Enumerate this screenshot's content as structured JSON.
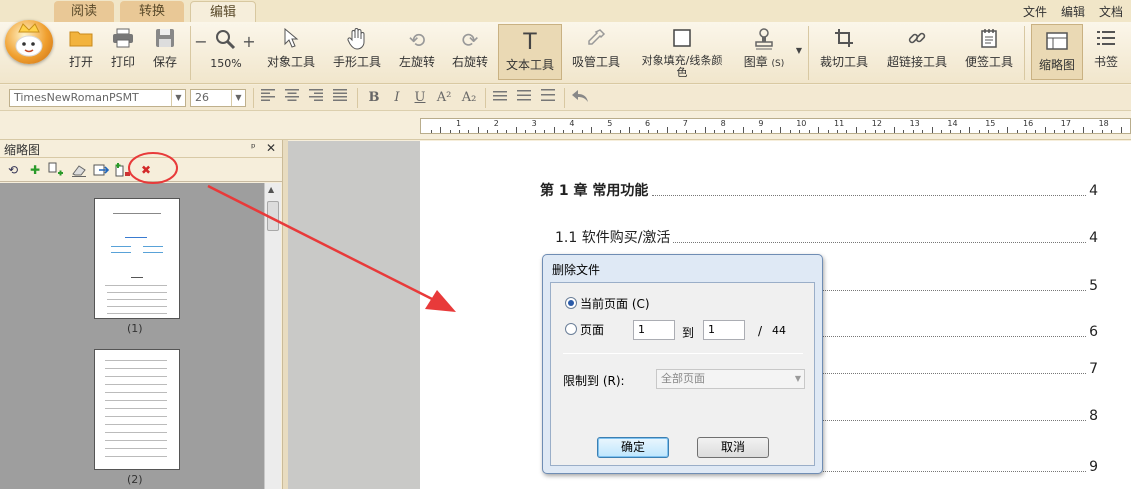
{
  "tabs": {
    "read": "阅读",
    "convert": "转换",
    "edit": "编辑"
  },
  "top_menu": {
    "file": "文件",
    "edit": "编辑",
    "doc": "文档"
  },
  "toolbar": {
    "open": "打开",
    "print": "打印",
    "save": "保存",
    "zoom_minus": "−",
    "zoom_plus": "+",
    "zoom": "150%",
    "object_tool": "对象工具",
    "hand_tool": "手形工具",
    "rotate_left": "左旋转",
    "rotate_right": "右旋转",
    "text_tool": "文本工具",
    "eyedropper": "吸管工具",
    "fill_color_line1": "对象填充/线条颜",
    "fill_color_line2": "色",
    "stamp": "图章",
    "stamp_suffix": "(S)",
    "crop": "裁切工具",
    "hyperlink": "超链接工具",
    "note": "便签工具",
    "thumbnail": "缩略图",
    "bookmark": "书签"
  },
  "format_bar": {
    "font": "TimesNewRomanPSMT",
    "size": "26",
    "bold": "B",
    "italic": "I",
    "underline": "U",
    "superscript": "A²",
    "subscript": "A₂"
  },
  "ruler": {
    "ticks": [
      "1",
      "2",
      "3",
      "4",
      "5",
      "6",
      "7",
      "8",
      "9",
      "10",
      "11",
      "12",
      "13",
      "14",
      "15",
      "16",
      "17",
      "18"
    ]
  },
  "panel": {
    "title": "缩略图",
    "pin": "ᵖ",
    "close": "✕",
    "thumbs": [
      {
        "label": "(1)"
      },
      {
        "label": "(2)"
      }
    ]
  },
  "document": {
    "toc": [
      {
        "text": "第 1 章  常用功能",
        "page": "4",
        "bold": true
      },
      {
        "text": "1.1 软件购买/激活",
        "page": "4",
        "bold": false
      }
    ],
    "page_numbers": [
      "5",
      "6",
      "7",
      "8",
      "9"
    ]
  },
  "dialog": {
    "title": "删除文件",
    "current_page": "当前页面 (C)",
    "pages": "页面",
    "from": "1",
    "to_label": "到",
    "to": "1",
    "slash": "/",
    "total": "44",
    "limit_label": "限制到 (R):",
    "limit_value": "全部页面",
    "ok": "确定",
    "cancel": "取消"
  },
  "colors": {
    "ribbon": "#f6eedb",
    "annotation": "#e83a3a",
    "dialog_frame": "#6f8db4"
  }
}
